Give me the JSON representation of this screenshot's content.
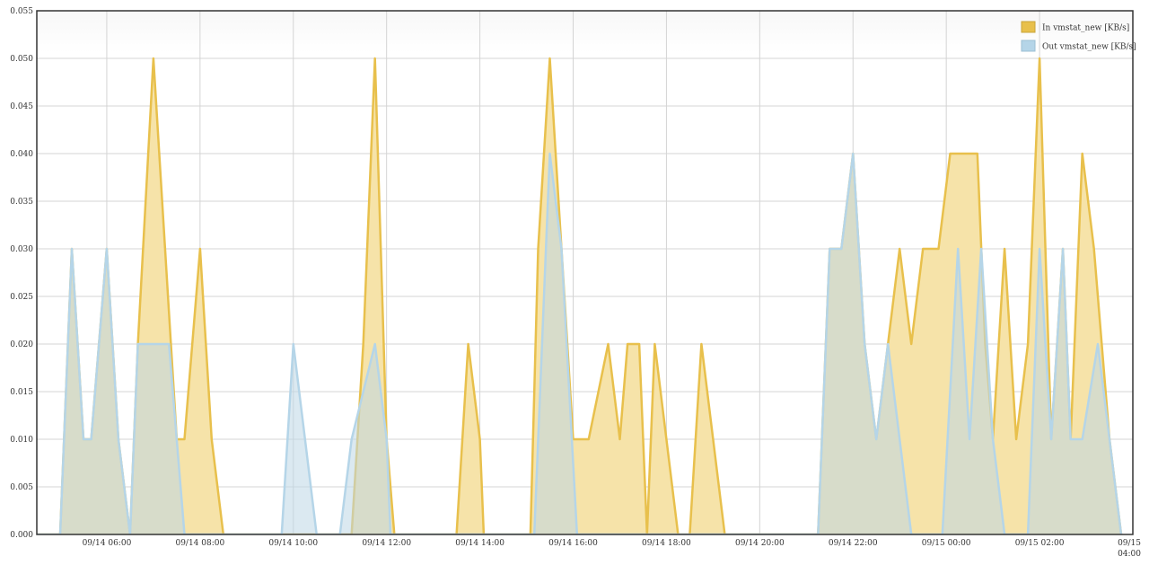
{
  "chart_data": {
    "type": "area",
    "title": "",
    "xlabel": "",
    "ylabel": "",
    "ylim": [
      0,
      0.055
    ],
    "xlim": [
      "2023-09-14T04:30",
      "2023-09-15T04:00"
    ],
    "grid": true,
    "legend_position": "top-right",
    "y_ticks": [
      "0.000",
      "0.005",
      "0.010",
      "0.015",
      "0.020",
      "0.025",
      "0.030",
      "0.035",
      "0.040",
      "0.045",
      "0.050",
      "0.055"
    ],
    "x_ticks": [
      {
        "t": "2023-09-14T06:00",
        "label": "09/14 06:00"
      },
      {
        "t": "2023-09-14T08:00",
        "label": "09/14 08:00"
      },
      {
        "t": "2023-09-14T10:00",
        "label": "09/14 10:00"
      },
      {
        "t": "2023-09-14T12:00",
        "label": "09/14 12:00"
      },
      {
        "t": "2023-09-14T14:00",
        "label": "09/14 14:00"
      },
      {
        "t": "2023-09-14T16:00",
        "label": "09/14 16:00"
      },
      {
        "t": "2023-09-14T18:00",
        "label": "09/14 18:00"
      },
      {
        "t": "2023-09-14T20:00",
        "label": "09/14 20:00"
      },
      {
        "t": "2023-09-14T22:00",
        "label": "09/14 22:00"
      },
      {
        "t": "2023-09-15T00:00",
        "label": "09/15 00:00"
      },
      {
        "t": "2023-09-15T02:00",
        "label": "09/15 02:00"
      },
      {
        "t": "2023-09-15T04:00",
        "label": "09/15\n04:00"
      }
    ],
    "series": [
      {
        "name": "In vmstat_new [KB/s]",
        "color": "#e8c04c",
        "fill": "#f6e3a9",
        "points": [
          [
            "2023-09-14T04:30",
            0
          ],
          [
            "2023-09-14T05:00",
            0
          ],
          [
            "2023-09-14T05:15",
            0.03
          ],
          [
            "2023-09-14T05:30",
            0.01
          ],
          [
            "2023-09-14T05:40",
            0.01
          ],
          [
            "2023-09-14T06:00",
            0.03
          ],
          [
            "2023-09-14T06:15",
            0.01
          ],
          [
            "2023-09-14T06:30",
            0
          ],
          [
            "2023-09-14T06:40",
            0.02
          ],
          [
            "2023-09-14T07:00",
            0.05
          ],
          [
            "2023-09-14T07:30",
            0.01
          ],
          [
            "2023-09-14T07:40",
            0.01
          ],
          [
            "2023-09-14T08:00",
            0.03
          ],
          [
            "2023-09-14T08:15",
            0.01
          ],
          [
            "2023-09-14T08:30",
            0
          ],
          [
            "2023-09-14T09:00",
            0
          ],
          [
            "2023-09-14T09:30",
            0
          ],
          [
            "2023-09-14T10:00",
            0
          ],
          [
            "2023-09-14T10:30",
            0
          ],
          [
            "2023-09-14T11:00",
            0
          ],
          [
            "2023-09-14T11:15",
            0
          ],
          [
            "2023-09-14T11:30",
            0.02
          ],
          [
            "2023-09-14T11:45",
            0.05
          ],
          [
            "2023-09-14T12:00",
            0.01
          ],
          [
            "2023-09-14T12:10",
            0
          ],
          [
            "2023-09-14T13:00",
            0
          ],
          [
            "2023-09-14T13:30",
            0
          ],
          [
            "2023-09-14T13:45",
            0.02
          ],
          [
            "2023-09-14T14:00",
            0.01
          ],
          [
            "2023-09-14T14:05",
            0
          ],
          [
            "2023-09-14T15:00",
            0
          ],
          [
            "2023-09-14T15:05",
            0
          ],
          [
            "2023-09-14T15:15",
            0.03
          ],
          [
            "2023-09-14T15:30",
            0.05
          ],
          [
            "2023-09-14T15:45",
            0.03
          ],
          [
            "2023-09-14T16:00",
            0.01
          ],
          [
            "2023-09-14T16:20",
            0.01
          ],
          [
            "2023-09-14T16:45",
            0.02
          ],
          [
            "2023-09-14T17:00",
            0.01
          ],
          [
            "2023-09-14T17:10",
            0.02
          ],
          [
            "2023-09-14T17:25",
            0.02
          ],
          [
            "2023-09-14T17:35",
            0
          ],
          [
            "2023-09-14T17:45",
            0.02
          ],
          [
            "2023-09-14T18:00",
            0.01
          ],
          [
            "2023-09-14T18:15",
            0
          ],
          [
            "2023-09-14T18:30",
            0
          ],
          [
            "2023-09-14T18:45",
            0.02
          ],
          [
            "2023-09-14T19:00",
            0.01
          ],
          [
            "2023-09-14T19:15",
            0
          ],
          [
            "2023-09-14T20:00",
            0
          ],
          [
            "2023-09-14T21:00",
            0
          ],
          [
            "2023-09-14T21:15",
            0
          ],
          [
            "2023-09-14T21:30",
            0.03
          ],
          [
            "2023-09-14T21:45",
            0.03
          ],
          [
            "2023-09-14T22:00",
            0.04
          ],
          [
            "2023-09-14T22:15",
            0.02
          ],
          [
            "2023-09-14T22:30",
            0.01
          ],
          [
            "2023-09-14T22:45",
            0.02
          ],
          [
            "2023-09-14T23:00",
            0.03
          ],
          [
            "2023-09-14T23:15",
            0.02
          ],
          [
            "2023-09-14T23:30",
            0.03
          ],
          [
            "2023-09-14T23:50",
            0.03
          ],
          [
            "2023-09-15T00:05",
            0.04
          ],
          [
            "2023-09-15T00:40",
            0.04
          ],
          [
            "2023-09-15T00:50",
            0.02
          ],
          [
            "2023-09-15T01:00",
            0.01
          ],
          [
            "2023-09-15T01:15",
            0.03
          ],
          [
            "2023-09-15T01:30",
            0.01
          ],
          [
            "2023-09-15T01:45",
            0.02
          ],
          [
            "2023-09-15T02:00",
            0.05
          ],
          [
            "2023-09-15T02:15",
            0.01
          ],
          [
            "2023-09-15T02:30",
            0.03
          ],
          [
            "2023-09-15T02:40",
            0.01
          ],
          [
            "2023-09-15T02:55",
            0.04
          ],
          [
            "2023-09-15T03:10",
            0.03
          ],
          [
            "2023-09-15T03:30",
            0.01
          ],
          [
            "2023-09-15T03:45",
            0
          ]
        ]
      },
      {
        "name": "Out vmstat_new [KB/s]",
        "color": "#b5d5e8",
        "fill": "rgba(190,215,230,0.55)",
        "points": [
          [
            "2023-09-14T04:30",
            0
          ],
          [
            "2023-09-14T05:00",
            0
          ],
          [
            "2023-09-14T05:15",
            0.03
          ],
          [
            "2023-09-14T05:30",
            0.01
          ],
          [
            "2023-09-14T05:40",
            0.01
          ],
          [
            "2023-09-14T06:00",
            0.03
          ],
          [
            "2023-09-14T06:15",
            0.01
          ],
          [
            "2023-09-14T06:30",
            0
          ],
          [
            "2023-09-14T06:40",
            0.02
          ],
          [
            "2023-09-14T07:20",
            0.02
          ],
          [
            "2023-09-14T07:40",
            0
          ],
          [
            "2023-09-14T08:30",
            0
          ],
          [
            "2023-09-14T09:30",
            0
          ],
          [
            "2023-09-14T09:45",
            0
          ],
          [
            "2023-09-14T10:00",
            0.02
          ],
          [
            "2023-09-14T10:15",
            0.01
          ],
          [
            "2023-09-14T10:30",
            0
          ],
          [
            "2023-09-14T11:00",
            0
          ],
          [
            "2023-09-14T11:15",
            0.01
          ],
          [
            "2023-09-14T11:45",
            0.02
          ],
          [
            "2023-09-14T12:00",
            0.01
          ],
          [
            "2023-09-14T12:05",
            0
          ],
          [
            "2023-09-14T13:00",
            0
          ],
          [
            "2023-09-14T14:00",
            0
          ],
          [
            "2023-09-14T15:00",
            0
          ],
          [
            "2023-09-14T15:10",
            0
          ],
          [
            "2023-09-14T15:30",
            0.04
          ],
          [
            "2023-09-14T15:45",
            0.03
          ],
          [
            "2023-09-14T16:05",
            0
          ],
          [
            "2023-09-14T17:00",
            0
          ],
          [
            "2023-09-14T18:00",
            0
          ],
          [
            "2023-09-14T19:00",
            0
          ],
          [
            "2023-09-14T20:00",
            0
          ],
          [
            "2023-09-14T21:00",
            0
          ],
          [
            "2023-09-14T21:15",
            0
          ],
          [
            "2023-09-14T21:30",
            0.03
          ],
          [
            "2023-09-14T21:45",
            0.03
          ],
          [
            "2023-09-14T22:00",
            0.04
          ],
          [
            "2023-09-14T22:15",
            0.02
          ],
          [
            "2023-09-14T22:30",
            0.01
          ],
          [
            "2023-09-14T22:45",
            0.02
          ],
          [
            "2023-09-14T23:00",
            0.01
          ],
          [
            "2023-09-14T23:15",
            0
          ],
          [
            "2023-09-14T23:30",
            0
          ],
          [
            "2023-09-14T23:55",
            0
          ],
          [
            "2023-09-15T00:15",
            0.03
          ],
          [
            "2023-09-15T00:30",
            0.01
          ],
          [
            "2023-09-15T00:45",
            0.03
          ],
          [
            "2023-09-15T01:00",
            0.01
          ],
          [
            "2023-09-15T01:15",
            0
          ],
          [
            "2023-09-15T01:45",
            0
          ],
          [
            "2023-09-15T02:00",
            0.03
          ],
          [
            "2023-09-15T02:15",
            0.01
          ],
          [
            "2023-09-15T02:30",
            0.03
          ],
          [
            "2023-09-15T02:40",
            0.01
          ],
          [
            "2023-09-15T02:55",
            0.01
          ],
          [
            "2023-09-15T03:15",
            0.02
          ],
          [
            "2023-09-15T03:30",
            0.01
          ],
          [
            "2023-09-15T03:45",
            0
          ]
        ]
      }
    ]
  }
}
